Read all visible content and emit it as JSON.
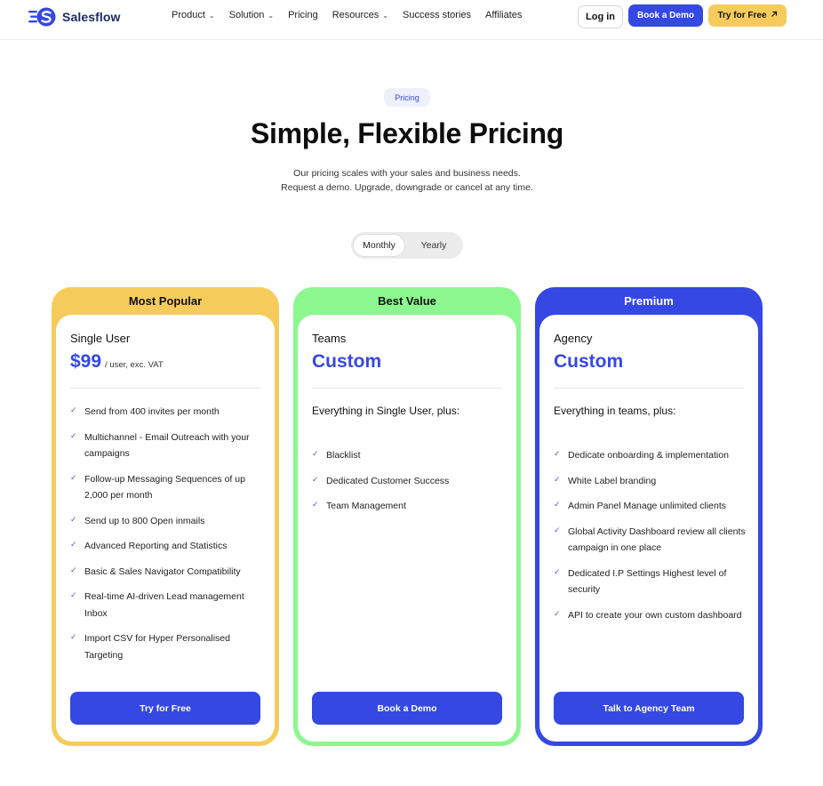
{
  "nav": {
    "brand": "Salesflow",
    "links": [
      {
        "label": "Product",
        "dropdown": true
      },
      {
        "label": "Solution",
        "dropdown": true
      },
      {
        "label": "Pricing",
        "dropdown": false
      },
      {
        "label": "Resources",
        "dropdown": true
      },
      {
        "label": "Success stories",
        "dropdown": false
      },
      {
        "label": "Affiliates",
        "dropdown": false
      }
    ],
    "login_label": "Log in",
    "demo_label": "Book a Demo",
    "try_label": "Try for Free",
    "try_icon": "arrow-up-right-icon"
  },
  "hero": {
    "pill": "Pricing",
    "title": "Simple, Flexible Pricing",
    "subtitle_line1": "Our pricing scales with your sales and business needs.",
    "subtitle_line2": "Request a demo. Upgrade, downgrade or cancel at any time."
  },
  "billing_toggle": {
    "options": [
      "Monthly",
      "Yearly"
    ],
    "selected": "Monthly"
  },
  "colors": {
    "brand_blue": "#3548e3",
    "popular_yellow": "#f5cc5c",
    "value_green": "#8cf78f",
    "premium_blue": "#3548e3"
  },
  "plans": [
    {
      "badge": "Most Popular",
      "name": "Single User",
      "price": "$99",
      "price_unit": "/ user, exc. VAT",
      "plus_text": "",
      "features": [
        "Send from 400 invites per month",
        "Multichannel - Email Outreach with your campaigns",
        "Follow-up Messaging Sequences of up 2,000 per month",
        "Send up to 800 Open inmails",
        "Advanced Reporting and Statistics",
        "Basic & Sales Navigator Compatibility",
        "Real-time AI-driven Lead management Inbox",
        "Import CSV for Hyper Personalised Targeting"
      ],
      "cta": "Try for Free"
    },
    {
      "badge": "Best Value",
      "name": "Teams",
      "price": "Custom",
      "price_unit": "",
      "plus_text": "Everything in Single User, plus:",
      "features": [
        "Blacklist",
        "Dedicated Customer Success",
        "Team Management"
      ],
      "cta": "Book a Demo"
    },
    {
      "badge": "Premium",
      "name": "Agency",
      "price": "Custom",
      "price_unit": "",
      "plus_text": "Everything in teams, plus:",
      "features": [
        "Dedicate onboarding & implementation",
        "White Label branding",
        "Admin Panel Manage unlimited clients",
        "Global Activity Dashboard review all clients campaign in one place",
        "Dedicated I.P Settings Highest level of security",
        "API to create your own custom dashboard"
      ],
      "cta": "Talk to Agency Team"
    }
  ]
}
